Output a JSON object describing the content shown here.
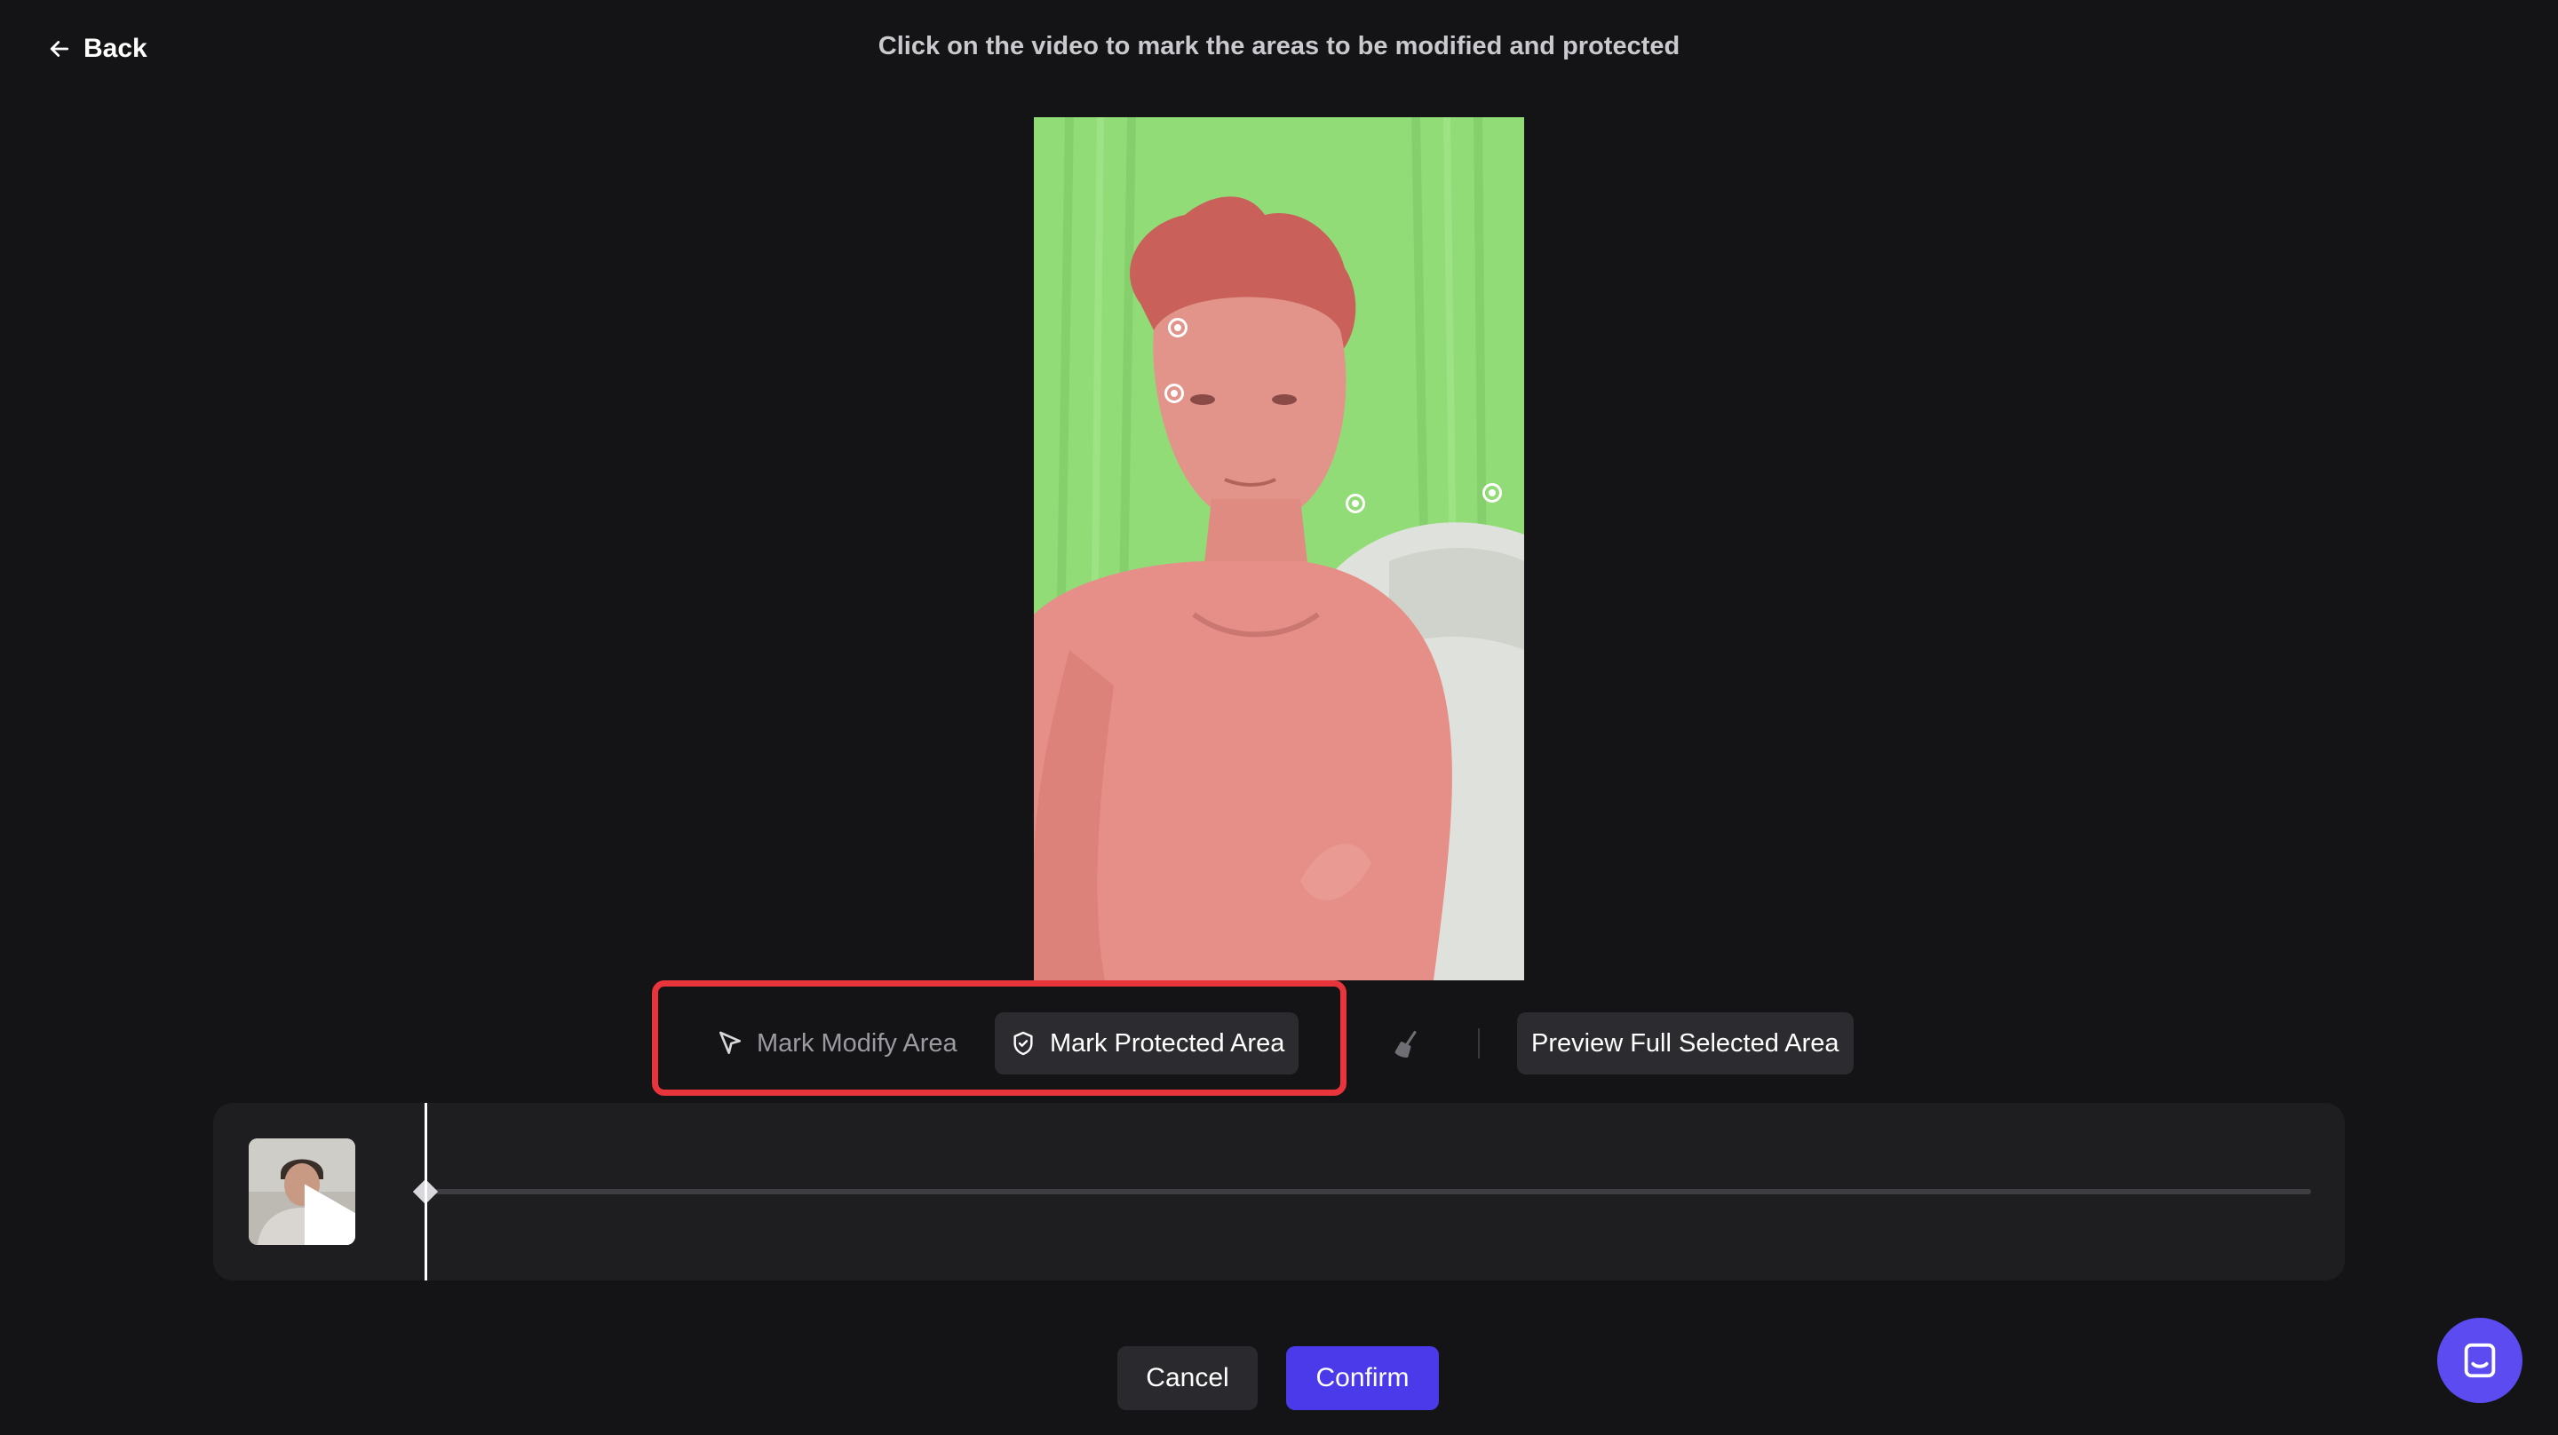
{
  "header": {
    "back_label": "Back",
    "instruction": "Click on the video to mark the areas to be modified and protected"
  },
  "toolbar": {
    "mark_modify_label": "Mark Modify Area",
    "mark_protected_label": "Mark Protected Area",
    "preview_label": "Preview Full Selected Area",
    "active_tool": "mark-protected-area"
  },
  "actions": {
    "cancel_label": "Cancel",
    "confirm_label": "Confirm"
  },
  "colors": {
    "background": "#141416",
    "accent": "#4a3aea",
    "highlight_border": "#e8353b",
    "modify_overlay": "#8fdc76",
    "protected_overlay": "#e58a80"
  },
  "icons": {
    "back": "arrow-left-icon",
    "modify": "cursor-arrow-icon",
    "protect": "shield-check-icon",
    "erase": "broom-icon",
    "play": "play-icon",
    "chat": "chat-icon"
  },
  "timeline": {
    "playhead_position": 0
  }
}
